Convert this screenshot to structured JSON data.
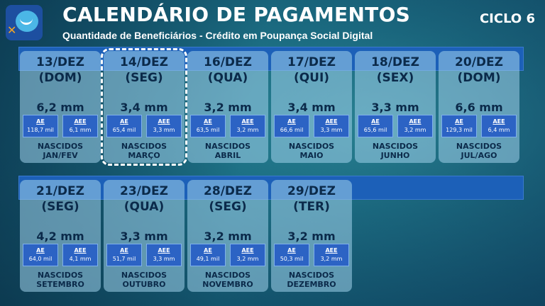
{
  "header": {
    "title": "CALENDÁRIO DE PAGAMENTOS",
    "subtitle": "Quantidade de Beneficiários - Crédito em Poupança Social Digital",
    "cycle": "CICLO 6"
  },
  "labels": {
    "ae": "AE",
    "aee": "AEE",
    "born": "NASCIDOS"
  },
  "colors": {
    "band": "#1c60b8",
    "box": "#2c63c4",
    "text": "#0b2a4a"
  },
  "cards": [
    {
      "date": "13/DEZ",
      "day": "(DOM)",
      "amount": "6,2 mm",
      "ae": "118,7 mil",
      "aee": "6,1 mm",
      "month": "JAN/FEV",
      "highlighted": false
    },
    {
      "date": "14/DEZ",
      "day": "(SEG)",
      "amount": "3,4 mm",
      "ae": "65,4 mil",
      "aee": "3,3 mm",
      "month": "MARÇO",
      "highlighted": true
    },
    {
      "date": "16/DEZ",
      "day": "(QUA)",
      "amount": "3,2 mm",
      "ae": "63,5 mil",
      "aee": "3,2 mm",
      "month": "ABRIL",
      "highlighted": false
    },
    {
      "date": "17/DEZ",
      "day": "(QUI)",
      "amount": "3,4 mm",
      "ae": "66,6 mil",
      "aee": "3,3 mm",
      "month": "MAIO",
      "highlighted": false
    },
    {
      "date": "18/DEZ",
      "day": "(SEX)",
      "amount": "3,3 mm",
      "ae": "65,6 mil",
      "aee": "3,2 mm",
      "month": "JUNHO",
      "highlighted": false
    },
    {
      "date": "20/DEZ",
      "day": "(DOM)",
      "amount": "6,6 mm",
      "ae": "129,3 mil",
      "aee": "6,4 mm",
      "month": "JUL/AGO",
      "highlighted": false
    },
    {
      "date": "21/DEZ",
      "day": "(SEG)",
      "amount": "4,2 mm",
      "ae": "64,0 mil",
      "aee": "4,1 mm",
      "month": "SETEMBRO",
      "highlighted": false
    },
    {
      "date": "23/DEZ",
      "day": "(QUA)",
      "amount": "3,3 mm",
      "ae": "51,7 mil",
      "aee": "3,3 mm",
      "month": "OUTUBRO",
      "highlighted": false
    },
    {
      "date": "28/DEZ",
      "day": "(SEG)",
      "amount": "3,2 mm",
      "ae": "49,1 mil",
      "aee": "3,2 mm",
      "month": "NOVEMBRO",
      "highlighted": false
    },
    {
      "date": "29/DEZ",
      "day": "(TER)",
      "amount": "3,2 mm",
      "ae": "50,3 mil",
      "aee": "3,2 mm",
      "month": "DEZEMBRO",
      "highlighted": false
    }
  ]
}
